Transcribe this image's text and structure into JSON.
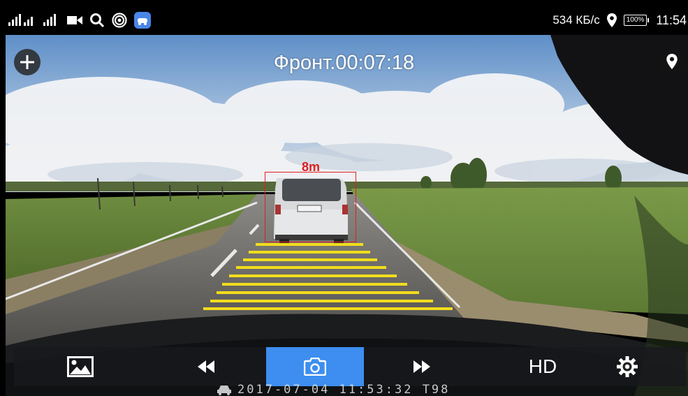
{
  "status_bar": {
    "left_icons": [
      "signal-icon",
      "wifi-signal-icon",
      "video-camera-icon",
      "search-icon",
      "hotspot-icon",
      "app-icon"
    ],
    "network_speed": "534 КБ/с",
    "battery_percent": "100%",
    "clock": "11:54"
  },
  "camera": {
    "title": "Фронт.00:07:18",
    "detection_label": "8m",
    "timestamp": "2017-07-04 11:53:32 T98"
  },
  "toolbar": {
    "hd_label": "HD",
    "active_button": "take-photo-button",
    "accent_color": "#3d8ef0"
  },
  "colors": {
    "lane_marking": "#f2dc1c",
    "detection_box": "#e02020"
  }
}
